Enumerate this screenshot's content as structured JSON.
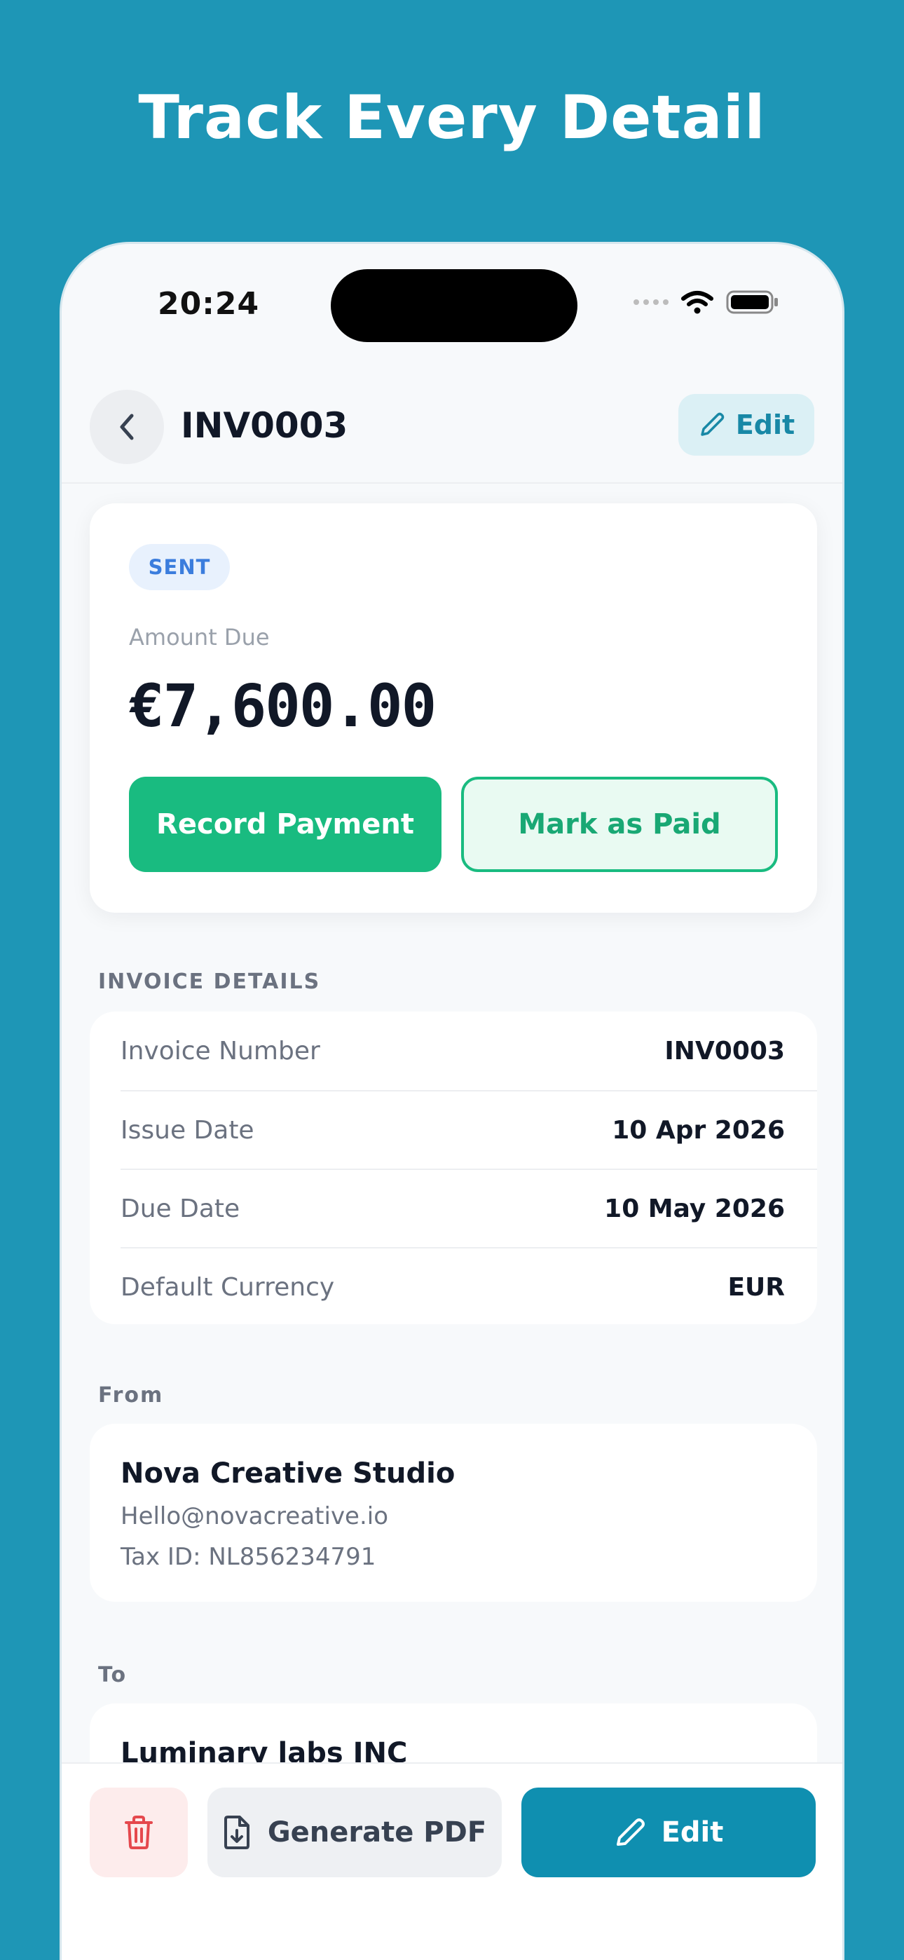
{
  "headline": "Track Every Detail",
  "status_bar": {
    "time": "20:24"
  },
  "nav": {
    "title": "INV0003",
    "edit_label": "Edit"
  },
  "summary": {
    "status": "SENT",
    "amount_label": "Amount Due",
    "amount": "€7,600.00",
    "record_payment_label": "Record Payment",
    "mark_paid_label": "Mark as Paid"
  },
  "invoice_details": {
    "section_title": "INVOICE DETAILS",
    "rows": [
      {
        "label": "Invoice Number",
        "value": "INV0003"
      },
      {
        "label": "Issue Date",
        "value": "10 Apr 2026"
      },
      {
        "label": "Due Date",
        "value": "10 May 2026"
      },
      {
        "label": "Default Currency",
        "value": "EUR"
      }
    ]
  },
  "from": {
    "section_title": "From",
    "name": "Nova Creative Studio",
    "email": "Hello@novacreative.io",
    "tax_id": "Tax ID: NL856234791"
  },
  "to": {
    "section_title": "To",
    "name": "Luminary labs INC"
  },
  "bottom_bar": {
    "generate_pdf_label": "Generate PDF",
    "edit_label": "Edit"
  },
  "colors": {
    "background": "#1e96b6",
    "accent": "#0f8fb0",
    "success": "#19bb80",
    "sent_badge": "#3b7ddd",
    "danger": "#e5484d"
  },
  "icons": [
    "chevron-left-icon",
    "pencil-icon",
    "wifi-icon",
    "battery-icon",
    "trash-icon",
    "file-download-icon"
  ]
}
